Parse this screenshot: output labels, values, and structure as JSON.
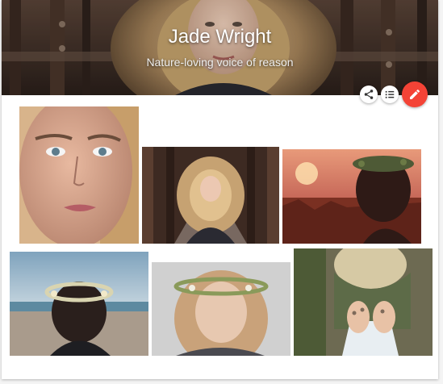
{
  "profile": {
    "name": "Jade Wright",
    "tagline": "Nature-loving voice of reason"
  },
  "actions": {
    "share_icon": "share-icon",
    "list_icon": "list-icon",
    "edit_icon": "edit-icon",
    "accent_color": "#f44336"
  },
  "gallery": {
    "photos": [
      {
        "subject": "close-up-face-portrait"
      },
      {
        "subject": "fur-hood-on-bridge"
      },
      {
        "subject": "flower-crown-sunset-field"
      },
      {
        "subject": "flower-crown-beach"
      },
      {
        "subject": "flower-crown-looking-down"
      },
      {
        "subject": "hands-with-rings"
      }
    ]
  }
}
